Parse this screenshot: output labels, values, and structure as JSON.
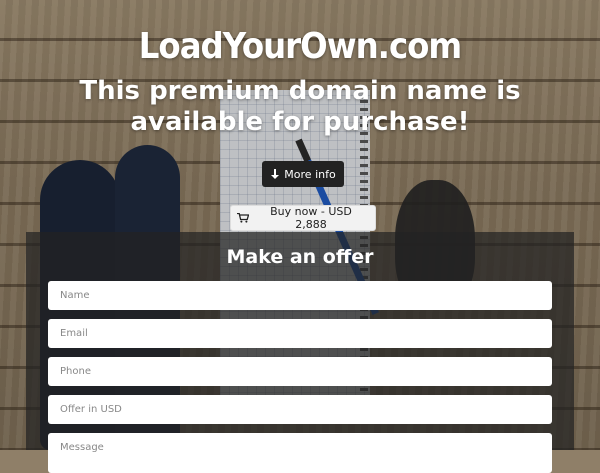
{
  "site": {
    "domain": "LoadYourOwn.com"
  },
  "headline": "This premium domain name is available for purchase!",
  "buttons": {
    "more_info": {
      "icon": "arrow-down-icon",
      "label": "More info"
    },
    "buy_now": {
      "icon": "cart-icon",
      "label": "Buy now - USD 2,888"
    }
  },
  "offer": {
    "title": "Make an offer",
    "fields": {
      "name_placeholder": "Name",
      "email_placeholder": "Email",
      "phone_placeholder": "Phone",
      "offer_placeholder": "Offer in USD",
      "message_placeholder": "Message"
    }
  },
  "colors": {
    "dark_button": "#222222",
    "light_button": "#f2f2f2",
    "panel": "#232323"
  }
}
